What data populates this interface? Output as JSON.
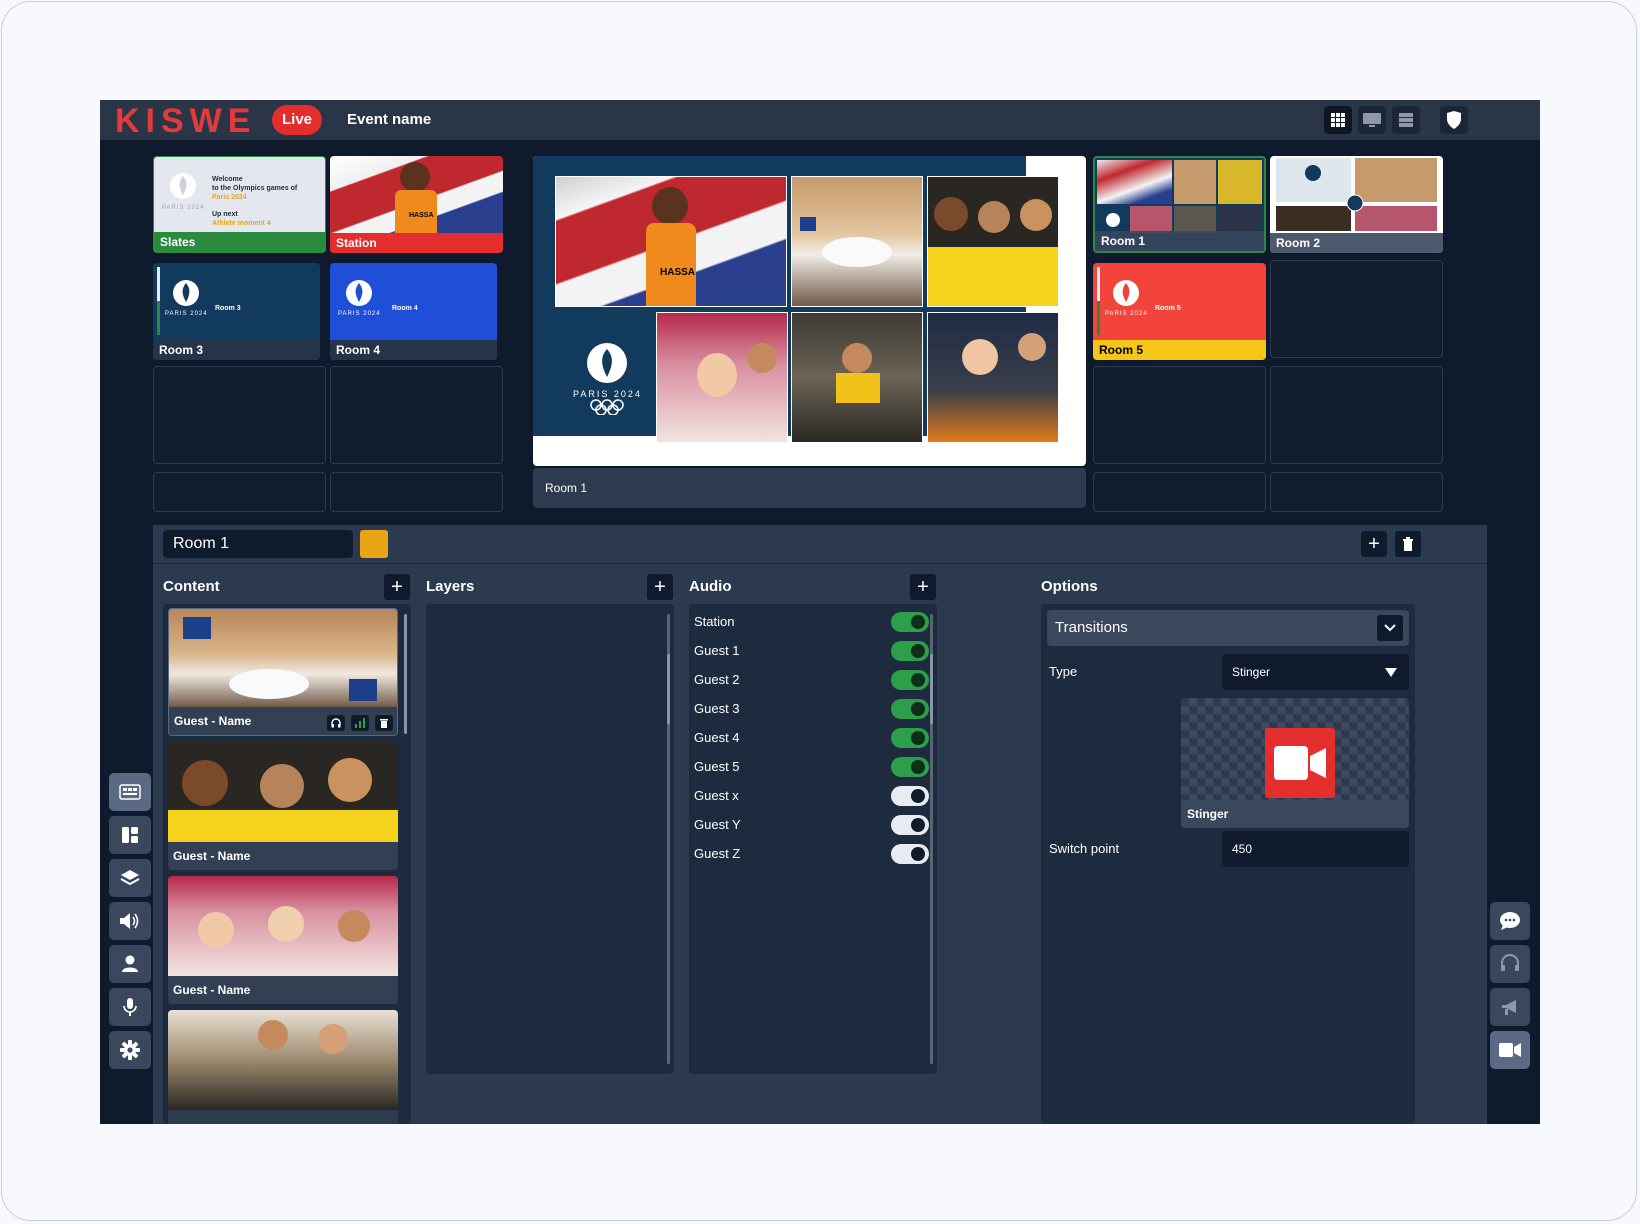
{
  "header": {
    "logo": "KISWE",
    "live_label": "Live",
    "event_name": "Event name",
    "view_buttons": [
      "grid-view-icon",
      "monitor-icon",
      "list-view-icon"
    ],
    "shield_icon": "shield-icon"
  },
  "sources": {
    "slates": {
      "label": "Slates",
      "welcome_line1": "Welcome",
      "welcome_line2": "to the Olympics games of",
      "welcome_line3": "Paris 2024",
      "up_next": "Up next",
      "athlete": "Athlete moment 4",
      "paris_text": "PARIS 2024"
    },
    "station": {
      "label": "Station",
      "shirt_text": "HASSA"
    },
    "room3": {
      "label": "Room 3",
      "inner": "Room 3",
      "paris_text": "PARIS 2024"
    },
    "room4": {
      "label": "Room 4",
      "inner": "Room 4",
      "paris_text": "PARIS 2024"
    },
    "room1": {
      "label": "Room 1"
    },
    "room2": {
      "label": "Room 2"
    },
    "room5": {
      "label": "Room 5",
      "inner": "Room 5",
      "paris_text": "PARIS 2024"
    }
  },
  "program": {
    "label": "Room 1",
    "paris_text": "PARIS 2024",
    "shirt_text": "HASSA"
  },
  "editor": {
    "room_name": "Room 1",
    "accent_color": "#e9a516",
    "add_label": "+",
    "content": {
      "title": "Content",
      "add_label": "+",
      "items": [
        {
          "name": "Guest - Name"
        },
        {
          "name": "Guest - Name"
        },
        {
          "name": "Guest - Name"
        }
      ]
    },
    "layers": {
      "title": "Layers",
      "add_label": "+"
    },
    "audio": {
      "title": "Audio",
      "add_label": "+",
      "rows": [
        {
          "name": "Station",
          "on": true
        },
        {
          "name": "Guest 1",
          "on": true
        },
        {
          "name": "Guest 2",
          "on": true
        },
        {
          "name": "Guest 3",
          "on": true
        },
        {
          "name": "Guest 4",
          "on": true
        },
        {
          "name": "Guest 5",
          "on": true
        },
        {
          "name": "Guest x",
          "on": false
        },
        {
          "name": "Guest Y",
          "on": false
        },
        {
          "name": "Guest Z",
          "on": false
        }
      ]
    },
    "options": {
      "title": "Options",
      "transitions_title": "Transitions",
      "type_label": "Type",
      "type_value": "Stinger",
      "stinger_caption": "Stinger",
      "switch_point_label": "Switch point",
      "switch_point_value": "450"
    }
  },
  "left_rail": [
    "multiview-icon",
    "layout-icon",
    "layers-icon",
    "speaker-icon",
    "person-icon",
    "microphone-icon",
    "settings-icon"
  ],
  "right_rail": [
    "chat-icon",
    "headset-icon",
    "megaphone-icon",
    "camera-icon"
  ],
  "colors": {
    "brand_red": "#e43a3a",
    "live_red": "#e42d2d",
    "slates_green": "#2a8a3e",
    "station_red": "#e42d2d",
    "room5_yellow": "#f5c518",
    "toggle_on": "#2d9e4a"
  }
}
